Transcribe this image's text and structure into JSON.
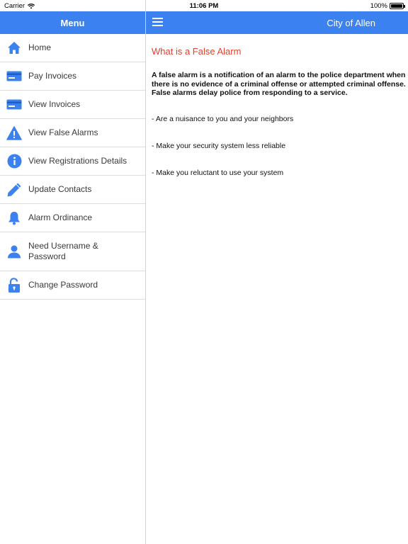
{
  "status_bar": {
    "carrier": "Carrier",
    "time": "11:06 PM",
    "battery_percent": "100%",
    "battery_level": 1.0
  },
  "sidebar": {
    "title": "Menu",
    "items": [
      {
        "label": "Home",
        "icon": "home-icon"
      },
      {
        "label": "Pay Invoices",
        "icon": "credit-card-icon"
      },
      {
        "label": "View Invoices",
        "icon": "credit-card-icon"
      },
      {
        "label": "View False Alarms",
        "icon": "warning-icon"
      },
      {
        "label": "View Registrations Details",
        "icon": "info-icon"
      },
      {
        "label": "Update Contacts",
        "icon": "pencil-icon"
      },
      {
        "label": "Alarm Ordinance",
        "icon": "bell-icon"
      },
      {
        "label": "Need Username & Password",
        "icon": "user-icon"
      },
      {
        "label": "Change Password",
        "icon": "unlock-icon"
      }
    ]
  },
  "header": {
    "title": "City of Allen"
  },
  "content": {
    "heading": "What is a False Alarm",
    "intro": "A false alarm is a notification of an alarm to the police department when there is no evidence of a criminal offense or attempted criminal offense. False alarms delay police from responding to a service.",
    "points": [
      "- Are a nuisance to you and your neighbors",
      "- Make your security system less reliable",
      "- Make you reluctant to use your system"
    ]
  },
  "colors": {
    "accent": "#3b82f0",
    "heading": "#e2402e"
  }
}
